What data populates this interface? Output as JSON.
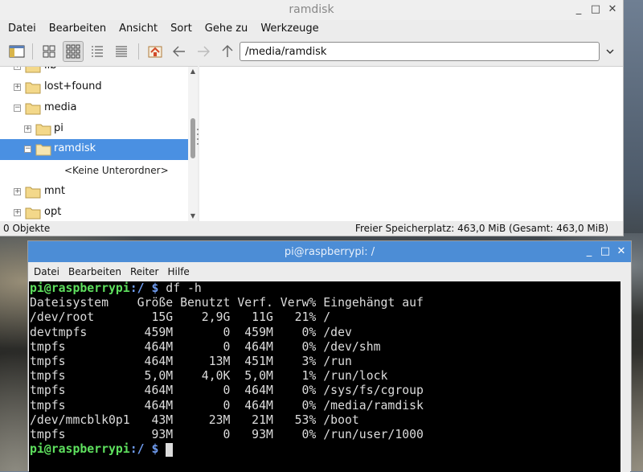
{
  "file_manager": {
    "title": "ramdisk",
    "window_controls": [
      "_",
      "□",
      "✕"
    ],
    "menu": [
      "Datei",
      "Bearbeiten",
      "Ansicht",
      "Sort",
      "Gehe zu",
      "Werkzeuge"
    ],
    "address": "/media/ramdisk",
    "tree": [
      {
        "label": "lib",
        "expander": "+",
        "indent": 0
      },
      {
        "label": "lost+found",
        "expander": "+",
        "indent": 0
      },
      {
        "label": "media",
        "expander": "−",
        "indent": 0
      },
      {
        "label": "pi",
        "expander": "+",
        "indent": 1
      },
      {
        "label": "ramdisk",
        "expander": "−",
        "indent": 1,
        "selected": true
      },
      {
        "label": "mnt",
        "expander": "+",
        "indent": 0
      },
      {
        "label": "opt",
        "expander": "+",
        "indent": 0
      }
    ],
    "no_subfolders": "<Keine Unterordner>",
    "status_left": "0 Objekte",
    "status_right": "Freier Speicherplatz: 463,0 MiB (Gesamt: 463,0 MiB)",
    "colors": {
      "selection": "#4a90e2",
      "folder": "#f3d88a"
    }
  },
  "terminal": {
    "title": "pi@raspberrypi: /",
    "window_controls": [
      "_",
      "□",
      "✕"
    ],
    "menu": [
      "Datei",
      "Bearbeiten",
      "Reiter",
      "Hilfe"
    ],
    "prompt_user": "pi@raspberrypi",
    "prompt_path": ":/ $",
    "command": "df -h",
    "header": "Dateisystem    Größe Benutzt Verf. Verw% Eingehängt auf",
    "rows": [
      "/dev/root        15G    2,9G   11G   21% /",
      "devtmpfs        459M       0  459M    0% /dev",
      "tmpfs           464M       0  464M    0% /dev/shm",
      "tmpfs           464M     13M  451M    3% /run",
      "tmpfs           5,0M    4,0K  5,0M    1% /run/lock",
      "tmpfs           464M       0  464M    0% /sys/fs/cgroup",
      "tmpfs           464M       0  464M    0% /media/ramdisk",
      "/dev/mmcblk0p1   43M     23M   21M   53% /boot",
      "tmpfs            93M       0   93M    0% /run/user/1000"
    ],
    "colors": {
      "titlebar": "#4c8dd6",
      "prompt_user": "#5ee05e",
      "prompt_path": "#6f9cf0"
    }
  }
}
